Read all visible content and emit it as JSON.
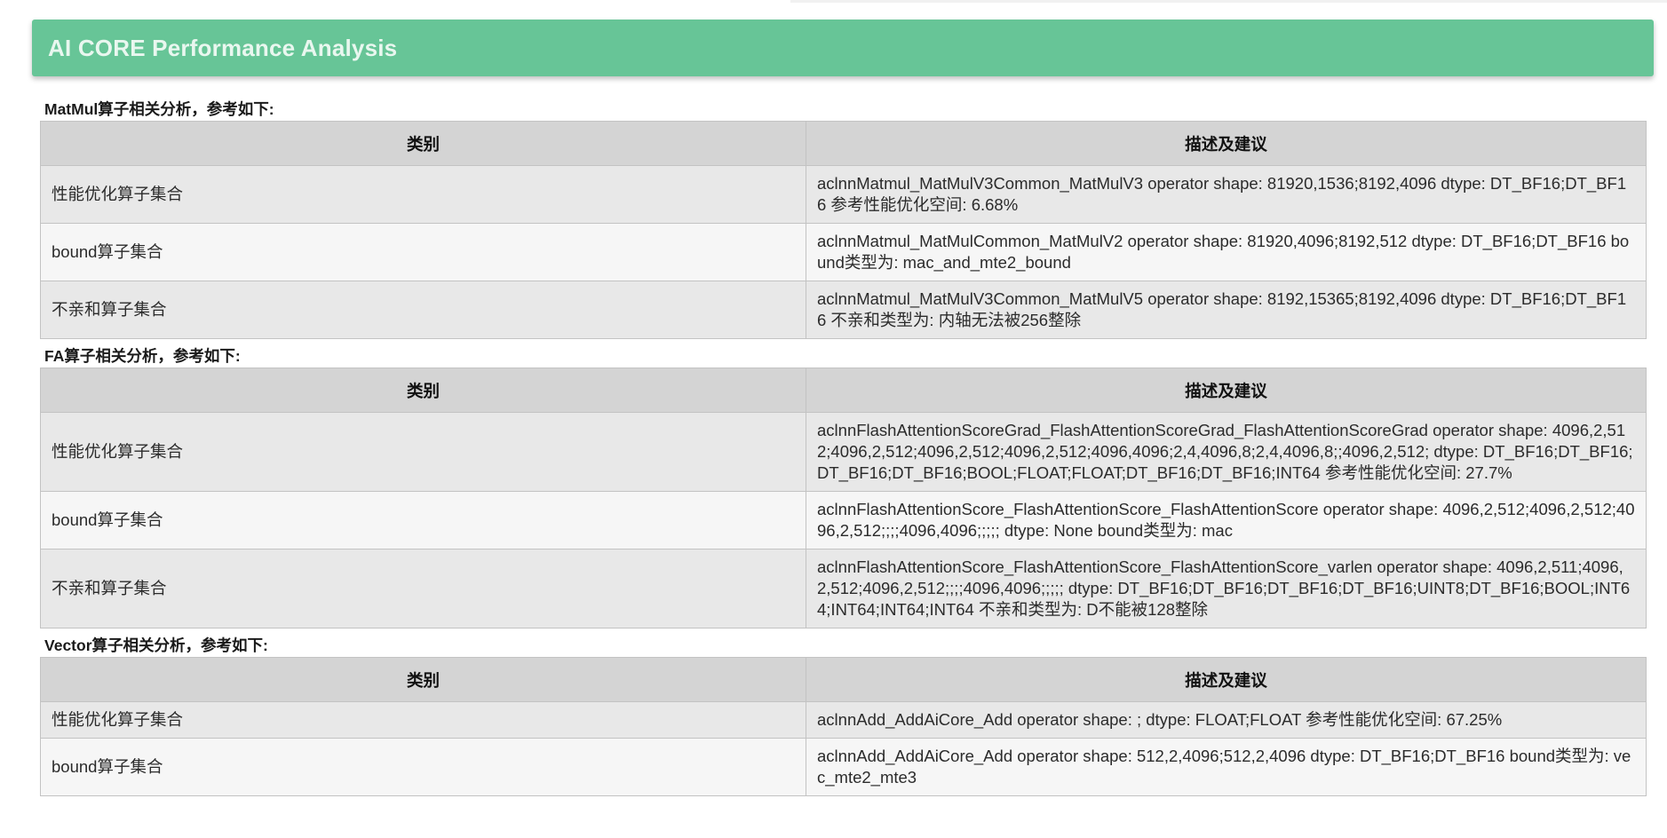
{
  "header": {
    "title": "AI CORE Performance Analysis"
  },
  "sections": [
    {
      "title": "MatMul算子相关分析，参考如下:",
      "columns": [
        "类别",
        "描述及建议"
      ],
      "rows": [
        {
          "category": "性能优化算子集合",
          "description": "aclnnMatmul_MatMulV3Common_MatMulV3 operator shape: 81920,1536;8192,4096 dtype: DT_BF16;DT_BF16 参考性能优化空间: 6.68%"
        },
        {
          "category": "bound算子集合",
          "description": "aclnnMatmul_MatMulCommon_MatMulV2 operator shape: 81920,4096;8192,512 dtype: DT_BF16;DT_BF16 bound类型为: mac_and_mte2_bound"
        },
        {
          "category": "不亲和算子集合",
          "description": "aclnnMatmul_MatMulV3Common_MatMulV5 operator shape: 8192,15365;8192,4096 dtype: DT_BF16;DT_BF16 不亲和类型为: 内轴无法被256整除"
        }
      ]
    },
    {
      "title": "FA算子相关分析，参考如下:",
      "columns": [
        "类别",
        "描述及建议"
      ],
      "rows": [
        {
          "category": "性能优化算子集合",
          "description": "aclnnFlashAttentionScoreGrad_FlashAttentionScoreGrad_FlashAttentionScoreGrad operator shape: 4096,2,512;4096,2,512;4096,2,512;4096,2,512;4096,4096;2,4,4096,8;2,4,4096,8;;4096,2,512; dtype: DT_BF16;DT_BF16;DT_BF16;DT_BF16;BOOL;FLOAT;FLOAT;DT_BF16;DT_BF16;INT64 参考性能优化空间: 27.7%"
        },
        {
          "category": "bound算子集合",
          "description": "aclnnFlashAttentionScore_FlashAttentionScore_FlashAttentionScore operator shape: 4096,2,512;4096,2,512;4096,2,512;;;;4096,4096;;;;; dtype: None bound类型为: mac"
        },
        {
          "category": "不亲和算子集合",
          "description": "aclnnFlashAttentionScore_FlashAttentionScore_FlashAttentionScore_varlen operator shape: 4096,2,511;4096,2,512;4096,2,512;;;;4096,4096;;;;; dtype: DT_BF16;DT_BF16;DT_BF16;DT_BF16;UINT8;DT_BF16;BOOL;INT64;INT64;INT64;INT64 不亲和类型为: D不能被128整除"
        }
      ]
    },
    {
      "title": "Vector算子相关分析，参考如下:",
      "columns": [
        "类别",
        "描述及建议"
      ],
      "rows": [
        {
          "category": "性能优化算子集合",
          "description": "aclnnAdd_AddAiCore_Add operator shape: ; dtype: FLOAT;FLOAT 参考性能优化空间: 67.25%"
        },
        {
          "category": "bound算子集合",
          "description": "aclnnAdd_AddAiCore_Add operator shape: 512,2,4096;512,2,4096 dtype: DT_BF16;DT_BF16 bound类型为: vec_mte2_mte3"
        }
      ]
    }
  ]
}
